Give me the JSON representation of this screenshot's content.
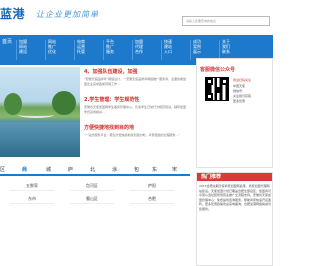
{
  "header": {
    "logo_text": "蓝港",
    "slogan": "让企业更加简单",
    "search_placeholder": "请输入您要查询的信息"
  },
  "nav": {
    "home_label": "首页",
    "items": [
      {
        "line1": "加盟",
        "line2": "网站",
        "line3": "建设"
      },
      {
        "line1": "网站",
        "line2": "推广",
        "line3": "优化"
      },
      {
        "line1": "电商",
        "line2": "运营",
        "line3": "托管"
      },
      {
        "line1": "平台",
        "line2": "推广",
        "line3": "服务"
      },
      {
        "line1": "加盟",
        "line2": "代理",
        "line3": "合作"
      },
      {
        "line1": "快速",
        "line2": "建站",
        "line3": "入口"
      },
      {
        "line1": "成功",
        "line2": "案例",
        "line3": "展示"
      },
      {
        "line1": "关于",
        "line2": "我们",
        "line3": "联系"
      }
    ]
  },
  "article": {
    "item1_title": "4、加强队伍建设，加强",
    "item1_text": "“安徽天使品牌商”网络设计，一安徽天使品牌商网络推广服务商，全面协助加盟企业完成各类营销工作...",
    "item2_title": "2.学生管理：学生规范性",
    "item2_text": "安徽省天使加盟网学生事务管理中心，负责学生日常行为规范培训，辅导加盟学员完成相关...",
    "item3_title": "方便快捷地找到目的地",
    "item3_text": "“一站式服务平台，帮您方便快捷地找到目的地，享受便捷的全程服务...”"
  },
  "wechat": {
    "title": "客服微信公众号",
    "label_red": "欢迎扫码关注",
    "label_1": "中国天使",
    "label_2": "微信号：",
    "label_3": "关注我们获取",
    "label_4": "更多优惠"
  },
  "area": {
    "tabs": [
      "区",
      "商",
      "城",
      "庐",
      "北",
      "涂",
      "包",
      "东",
      "宋"
    ],
    "active_tab": 1,
    "cells": [
      "五鲜家",
      "包河区",
      "庐阳",
      "东市",
      "蜀山区",
      "合肥"
    ]
  },
  "hot": {
    "title": "热门推荐",
    "body_prefix": "",
    "body_highlight": "",
    "body": "2015合肥先期天使商家加盟网蓝港，商家加盟代理网站建设，天使加盟计划已覆盖合肥全部县区，加盟商可享受从选址装修到营业推广全流程支持。安徽省天使加盟管理中心：免费提供咨询服务，帮助商家快速开店盈利。更多优惠政策欢迎来电垂询，合肥蓝港网络竭诚为您服务。"
  },
  "colors": {
    "nav_blue": "#1d79cb",
    "accent_red": "#d83a3a",
    "title_red": "#d22d2d"
  }
}
